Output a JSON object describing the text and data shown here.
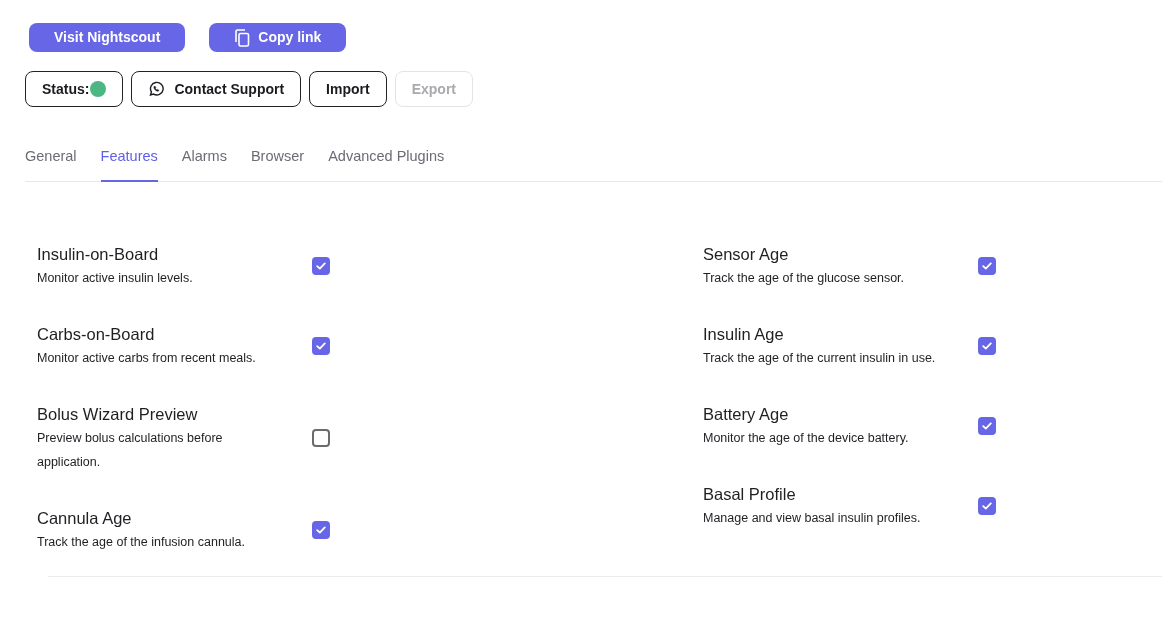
{
  "top_buttons": [
    {
      "label": "Visit Nightscout",
      "kind": "visit"
    },
    {
      "label": "Copy link",
      "kind": "copy"
    }
  ],
  "actions": [
    {
      "kind": "status",
      "label": "Status:",
      "color": "#4cb782",
      "disabled": false
    },
    {
      "kind": "support",
      "label": "Contact Support",
      "disabled": false
    },
    {
      "kind": "plain",
      "label": "Import",
      "disabled": false
    },
    {
      "kind": "plain",
      "label": "Export",
      "disabled": true
    }
  ],
  "tabs": [
    {
      "label": "General",
      "selected": false
    },
    {
      "label": "Features",
      "selected": true
    },
    {
      "label": "Alarms",
      "selected": false
    },
    {
      "label": "Browser",
      "selected": false
    },
    {
      "label": "Advanced Plugins",
      "selected": false
    }
  ],
  "features": [
    [
      {
        "title": "Insulin-on-Board",
        "description": "Monitor active insulin levels.",
        "checked": true
      },
      {
        "title": "Carbs-on-Board",
        "description": "Monitor active carbs from recent meals.",
        "checked": true
      },
      {
        "title": "Bolus Wizard Preview",
        "description": "Preview bolus calculations before application.",
        "checked": false
      },
      {
        "title": "Cannula Age",
        "description": "Track the age of the infusion cannula.",
        "checked": true
      }
    ],
    [
      {
        "title": "Sensor Age",
        "description": "Track the age of the glucose sensor.",
        "checked": true
      },
      {
        "title": "Insulin Age",
        "description": "Track the age of the current insulin in use.",
        "checked": true
      },
      {
        "title": "Battery Age",
        "description": "Monitor the age of the device battery.",
        "checked": true
      },
      {
        "title": "Basal Profile",
        "description": "Manage and view basal insulin profiles.",
        "checked": true
      }
    ]
  ]
}
